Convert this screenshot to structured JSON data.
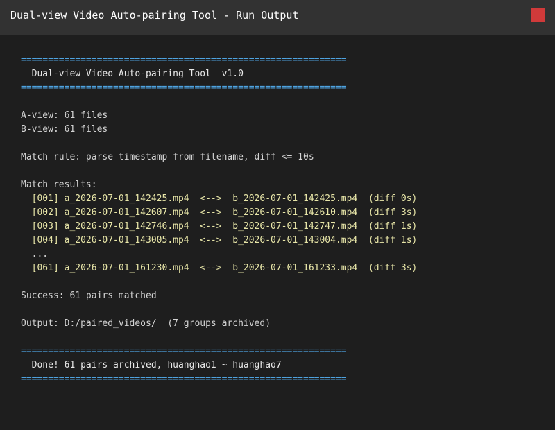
{
  "window": {
    "title": "Dual-view Video Auto-pairing Tool - Run Output"
  },
  "terminal": {
    "separator": "============================================================",
    "header_title": "  Dual-view Video Auto-pairing Tool  v1.0",
    "a_view": "A-view: 61 files",
    "b_view": "B-view: 61 files",
    "match_rule": "Match rule: parse timestamp from filename, diff <= 10s",
    "results_heading": "Match results:",
    "pairs": [
      "  [001] a_2026-07-01_142425.mp4  <-->  b_2026-07-01_142425.mp4  (diff 0s)",
      "  [002] a_2026-07-01_142607.mp4  <-->  b_2026-07-01_142610.mp4  (diff 3s)",
      "  [003] a_2026-07-01_142746.mp4  <-->  b_2026-07-01_142747.mp4  (diff 1s)",
      "  [004] a_2026-07-01_143005.mp4  <-->  b_2026-07-01_143004.mp4  (diff 1s)"
    ],
    "ellipsis": "  ...",
    "last_pair": "  [061] a_2026-07-01_161230.mp4  <-->  b_2026-07-01_161233.mp4  (diff 3s)",
    "success": "Success: 61 pairs matched",
    "output": "Output: D:/paired_videos/  (7 groups archived)",
    "done": "  Done! 61 pairs archived, huanghao1 ~ huanghao7"
  }
}
